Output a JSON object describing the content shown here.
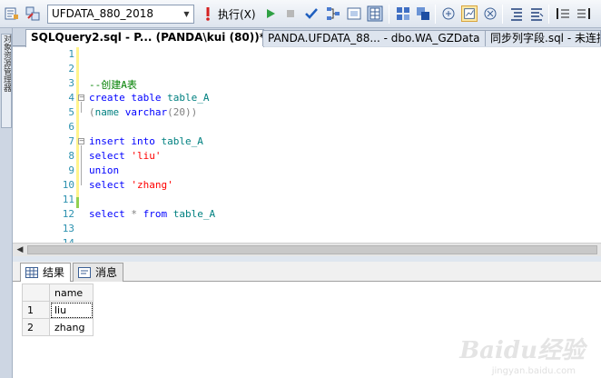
{
  "toolbar": {
    "database": "UFDATA_880_2018",
    "execute_label": "执行(X)",
    "icons": [
      "query-options-icon",
      "connect-icon",
      "database-dropdown",
      "execute-icon",
      "debug-run-icon",
      "stop-icon",
      "parse-check-icon",
      "display-plan-icon",
      "query-designer-icon",
      "results-to-text-icon",
      "results-to-grid-icon",
      "results-to-file-icon",
      "include-plan-icon",
      "client-stats-icon",
      "sqlcmd-mode-icon",
      "comment-icon",
      "uncomment-icon",
      "decrease-indent-icon",
      "increase-indent-icon"
    ]
  },
  "left_dock": {
    "label": "对象资源管理器"
  },
  "tabs": [
    {
      "label": "SQLQuery2.sql - P... (PANDA\\kui (80))*",
      "active": true
    },
    {
      "label": "PANDA.UFDATA_88... - dbo.WA_GZData",
      "active": false
    },
    {
      "label": "同步列字段.sql - 未连接",
      "active": false
    }
  ],
  "editor": {
    "line_numbers": [
      "1",
      "2",
      "3",
      "4",
      "5",
      "6",
      "7",
      "8",
      "9",
      "10",
      "11",
      "12",
      "13",
      "14"
    ],
    "lines": {
      "l3_comment": "--创建A表",
      "l4_kw": "create table ",
      "l4_tbl": "table_A",
      "l5_open": "(",
      "l5_col": "name ",
      "l5_type": "varchar",
      "l5_args": "(20))",
      "l7_kw": "insert into ",
      "l7_tbl": "table_A",
      "l8_kw": "select ",
      "l8_str": "'liu'",
      "l9_kw": "union",
      "l10_kw": "select ",
      "l10_str": "'zhang'",
      "l12_kw1": "select ",
      "l12_star": "* ",
      "l12_kw2": "from ",
      "l12_tbl": "table_A"
    }
  },
  "results": {
    "tabs": [
      {
        "label": "结果",
        "active": true
      },
      {
        "label": "消息",
        "active": false
      }
    ],
    "columns": [
      "name"
    ],
    "rows": [
      {
        "num": "1",
        "name": "liu"
      },
      {
        "num": "2",
        "name": "zhang"
      }
    ]
  },
  "watermark": {
    "brand": "Baidu经验",
    "sub": "jingyan.baidu.com"
  }
}
